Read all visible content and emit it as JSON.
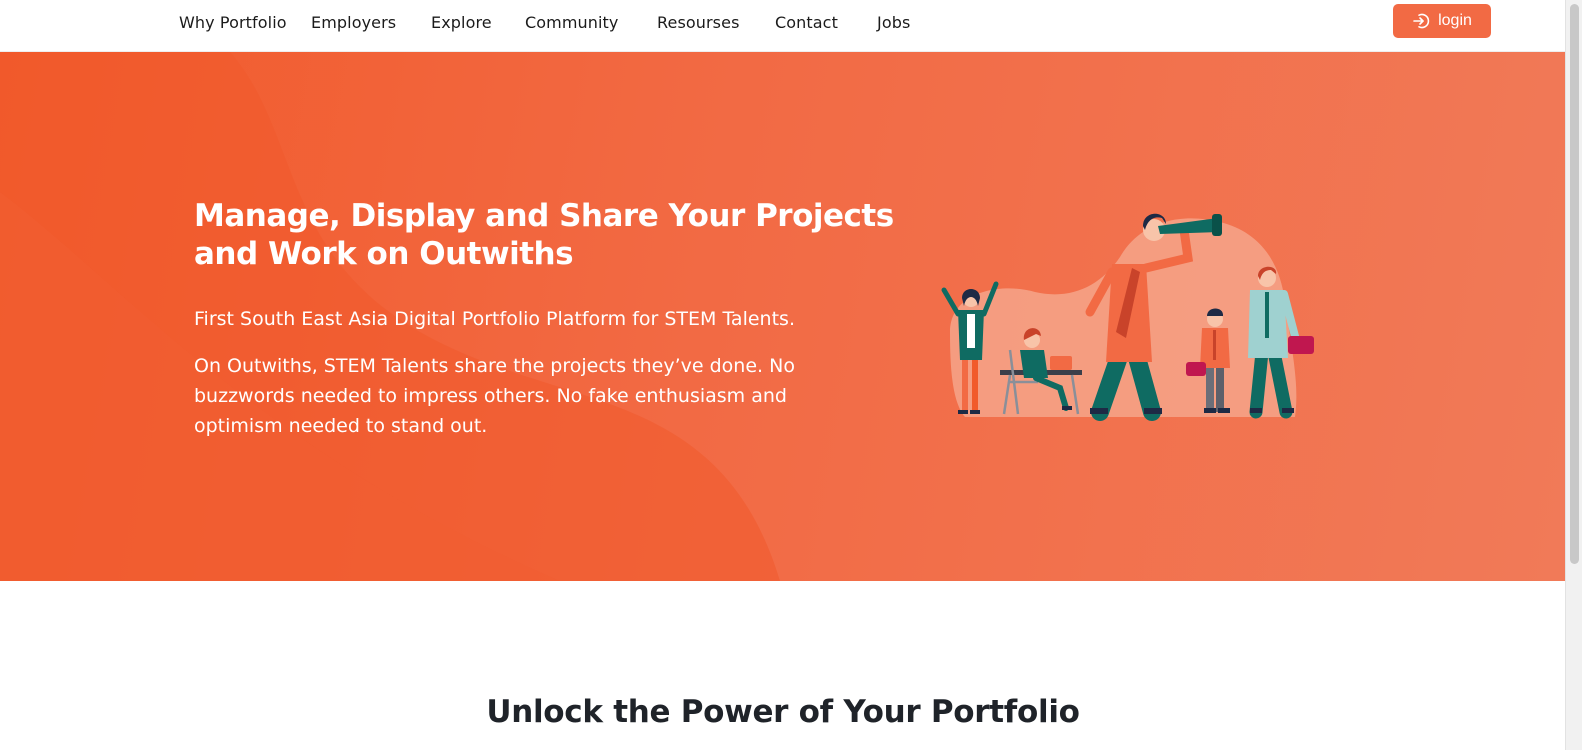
{
  "nav": {
    "links": [
      {
        "label": "Why Portfolio"
      },
      {
        "label": "Employers"
      },
      {
        "label": "Explore"
      },
      {
        "label": "Community"
      },
      {
        "label": "Resourses"
      },
      {
        "label": "Contact"
      },
      {
        "label": "Jobs"
      }
    ],
    "login_label": "login",
    "login_icon": "login-arrow-icon"
  },
  "hero": {
    "title": "Manage, Display and Share Your Projects and Work on Outwiths",
    "subtitle": "First South East Asia Digital Portfolio Platform for STEM Talents.",
    "description": "On Outwiths, STEM Talents share the projects they’ve done. No buzzwords needed to impress others. No fake enthusiasm and optimism needed to stand out.",
    "illustration": "team-with-telescope-illustration"
  },
  "section": {
    "title": "Unlock the Power of Your Portfolio"
  },
  "colors": {
    "brand_orange": "#f26a44",
    "hero_dark": "#f15a2b",
    "teal": "#0f6b62",
    "text_dark": "#1f2329"
  }
}
